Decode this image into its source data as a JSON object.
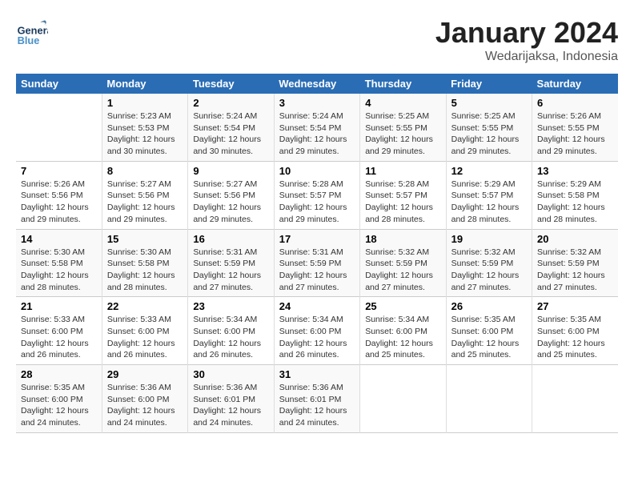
{
  "header": {
    "logo_general": "General",
    "logo_blue": "Blue",
    "month_title": "January 2024",
    "location": "Wedarijaksa, Indonesia"
  },
  "days_of_week": [
    "Sunday",
    "Monday",
    "Tuesday",
    "Wednesday",
    "Thursday",
    "Friday",
    "Saturday"
  ],
  "weeks": [
    [
      {
        "day": "",
        "sunrise": "",
        "sunset": "",
        "daylight": ""
      },
      {
        "day": "1",
        "sunrise": "Sunrise: 5:23 AM",
        "sunset": "Sunset: 5:53 PM",
        "daylight": "Daylight: 12 hours and 30 minutes."
      },
      {
        "day": "2",
        "sunrise": "Sunrise: 5:24 AM",
        "sunset": "Sunset: 5:54 PM",
        "daylight": "Daylight: 12 hours and 30 minutes."
      },
      {
        "day": "3",
        "sunrise": "Sunrise: 5:24 AM",
        "sunset": "Sunset: 5:54 PM",
        "daylight": "Daylight: 12 hours and 29 minutes."
      },
      {
        "day": "4",
        "sunrise": "Sunrise: 5:25 AM",
        "sunset": "Sunset: 5:55 PM",
        "daylight": "Daylight: 12 hours and 29 minutes."
      },
      {
        "day": "5",
        "sunrise": "Sunrise: 5:25 AM",
        "sunset": "Sunset: 5:55 PM",
        "daylight": "Daylight: 12 hours and 29 minutes."
      },
      {
        "day": "6",
        "sunrise": "Sunrise: 5:26 AM",
        "sunset": "Sunset: 5:55 PM",
        "daylight": "Daylight: 12 hours and 29 minutes."
      }
    ],
    [
      {
        "day": "7",
        "sunrise": "Sunrise: 5:26 AM",
        "sunset": "Sunset: 5:56 PM",
        "daylight": "Daylight: 12 hours and 29 minutes."
      },
      {
        "day": "8",
        "sunrise": "Sunrise: 5:27 AM",
        "sunset": "Sunset: 5:56 PM",
        "daylight": "Daylight: 12 hours and 29 minutes."
      },
      {
        "day": "9",
        "sunrise": "Sunrise: 5:27 AM",
        "sunset": "Sunset: 5:56 PM",
        "daylight": "Daylight: 12 hours and 29 minutes."
      },
      {
        "day": "10",
        "sunrise": "Sunrise: 5:28 AM",
        "sunset": "Sunset: 5:57 PM",
        "daylight": "Daylight: 12 hours and 29 minutes."
      },
      {
        "day": "11",
        "sunrise": "Sunrise: 5:28 AM",
        "sunset": "Sunset: 5:57 PM",
        "daylight": "Daylight: 12 hours and 28 minutes."
      },
      {
        "day": "12",
        "sunrise": "Sunrise: 5:29 AM",
        "sunset": "Sunset: 5:57 PM",
        "daylight": "Daylight: 12 hours and 28 minutes."
      },
      {
        "day": "13",
        "sunrise": "Sunrise: 5:29 AM",
        "sunset": "Sunset: 5:58 PM",
        "daylight": "Daylight: 12 hours and 28 minutes."
      }
    ],
    [
      {
        "day": "14",
        "sunrise": "Sunrise: 5:30 AM",
        "sunset": "Sunset: 5:58 PM",
        "daylight": "Daylight: 12 hours and 28 minutes."
      },
      {
        "day": "15",
        "sunrise": "Sunrise: 5:30 AM",
        "sunset": "Sunset: 5:58 PM",
        "daylight": "Daylight: 12 hours and 28 minutes."
      },
      {
        "day": "16",
        "sunrise": "Sunrise: 5:31 AM",
        "sunset": "Sunset: 5:59 PM",
        "daylight": "Daylight: 12 hours and 27 minutes."
      },
      {
        "day": "17",
        "sunrise": "Sunrise: 5:31 AM",
        "sunset": "Sunset: 5:59 PM",
        "daylight": "Daylight: 12 hours and 27 minutes."
      },
      {
        "day": "18",
        "sunrise": "Sunrise: 5:32 AM",
        "sunset": "Sunset: 5:59 PM",
        "daylight": "Daylight: 12 hours and 27 minutes."
      },
      {
        "day": "19",
        "sunrise": "Sunrise: 5:32 AM",
        "sunset": "Sunset: 5:59 PM",
        "daylight": "Daylight: 12 hours and 27 minutes."
      },
      {
        "day": "20",
        "sunrise": "Sunrise: 5:32 AM",
        "sunset": "Sunset: 5:59 PM",
        "daylight": "Daylight: 12 hours and 27 minutes."
      }
    ],
    [
      {
        "day": "21",
        "sunrise": "Sunrise: 5:33 AM",
        "sunset": "Sunset: 6:00 PM",
        "daylight": "Daylight: 12 hours and 26 minutes."
      },
      {
        "day": "22",
        "sunrise": "Sunrise: 5:33 AM",
        "sunset": "Sunset: 6:00 PM",
        "daylight": "Daylight: 12 hours and 26 minutes."
      },
      {
        "day": "23",
        "sunrise": "Sunrise: 5:34 AM",
        "sunset": "Sunset: 6:00 PM",
        "daylight": "Daylight: 12 hours and 26 minutes."
      },
      {
        "day": "24",
        "sunrise": "Sunrise: 5:34 AM",
        "sunset": "Sunset: 6:00 PM",
        "daylight": "Daylight: 12 hours and 26 minutes."
      },
      {
        "day": "25",
        "sunrise": "Sunrise: 5:34 AM",
        "sunset": "Sunset: 6:00 PM",
        "daylight": "Daylight: 12 hours and 25 minutes."
      },
      {
        "day": "26",
        "sunrise": "Sunrise: 5:35 AM",
        "sunset": "Sunset: 6:00 PM",
        "daylight": "Daylight: 12 hours and 25 minutes."
      },
      {
        "day": "27",
        "sunrise": "Sunrise: 5:35 AM",
        "sunset": "Sunset: 6:00 PM",
        "daylight": "Daylight: 12 hours and 25 minutes."
      }
    ],
    [
      {
        "day": "28",
        "sunrise": "Sunrise: 5:35 AM",
        "sunset": "Sunset: 6:00 PM",
        "daylight": "Daylight: 12 hours and 24 minutes."
      },
      {
        "day": "29",
        "sunrise": "Sunrise: 5:36 AM",
        "sunset": "Sunset: 6:00 PM",
        "daylight": "Daylight: 12 hours and 24 minutes."
      },
      {
        "day": "30",
        "sunrise": "Sunrise: 5:36 AM",
        "sunset": "Sunset: 6:01 PM",
        "daylight": "Daylight: 12 hours and 24 minutes."
      },
      {
        "day": "31",
        "sunrise": "Sunrise: 5:36 AM",
        "sunset": "Sunset: 6:01 PM",
        "daylight": "Daylight: 12 hours and 24 minutes."
      },
      {
        "day": "",
        "sunrise": "",
        "sunset": "",
        "daylight": ""
      },
      {
        "day": "",
        "sunrise": "",
        "sunset": "",
        "daylight": ""
      },
      {
        "day": "",
        "sunrise": "",
        "sunset": "",
        "daylight": ""
      }
    ]
  ]
}
